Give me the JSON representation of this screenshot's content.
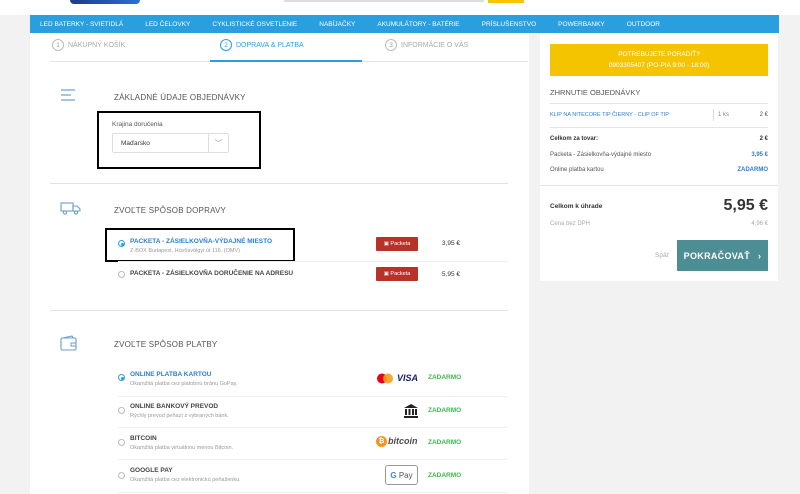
{
  "nav": [
    "LED BATERKY - SVIETIDLÁ",
    "LED ČELOVKY",
    "CYKLISTICKÉ OSVETLENIE",
    "NABÍJAČKY",
    "AKUMULÁTORY - BATÉRIE",
    "PRÍSLUŠENSTVO",
    "POWERBANKY",
    "OUTDOOR"
  ],
  "steps": [
    {
      "num": "1",
      "label": "NÁKUPNÝ KOŠÍK"
    },
    {
      "num": "2",
      "label": "DOPRAVA & PLATBA"
    },
    {
      "num": "3",
      "label": "INFORMÁCIE O VÁS"
    }
  ],
  "basic": {
    "title": "ZÁKLADNÉ ÚDAJE OBJEDNÁVKY",
    "country_label": "Krajina doručenia",
    "country_value": "Maďarsko",
    "chevron": "﹀"
  },
  "shipping": {
    "title": "ZVOĽTE SPÔSOB DOPRAVY",
    "badge": "Packeta",
    "options": [
      {
        "title": "PACKETA - ZÁSIELKOVŇA-VÝDAJNÉ MIESTO",
        "sub": "Z-BOX Budapest, Húvösvölgyi út 116. (OMV)",
        "price": "3,95 €",
        "selected": true
      },
      {
        "title": "PACKETA - ZÁSIELKOVŇA DORUČENIE NA ADRESU",
        "sub": "",
        "price": "5,95 €",
        "selected": false
      }
    ]
  },
  "payment": {
    "title": "ZVOĽTE SPÔSOB PLATBY",
    "free_label": "ZADARMO",
    "options": [
      {
        "title": "ONLINE PLATBA KARTOU",
        "sub": "Okamžitá platba cez platobnú bránu GoPay.",
        "logo": "visa-mastercard",
        "selected": true
      },
      {
        "title": "ONLINE BANKOVÝ PREVOD",
        "sub": "Rýchly prevod peňazí z vybraných bánk.",
        "logo": "bank-icon",
        "selected": false
      },
      {
        "title": "BITCOIN",
        "sub": "Okamžitá platba virtuálnou menou Bitcoin.",
        "logo": "bitcoin",
        "selected": false
      },
      {
        "title": "GOOGLE PAY",
        "sub": "Okamžitá platba cez elektronickú peňaženku.",
        "logo": "gpay",
        "selected": false
      }
    ],
    "visa_text": "VISA",
    "bitcoin_text": "bitcoin",
    "gpay_text": "Pay"
  },
  "summary": {
    "help_line1": "POTREBUJETE PORADIŤ?",
    "help_line2": "0903305407 (PO-PIA 9:00 - 18:00)",
    "title": "ZHRNUTIE OBJEDNÁVKY",
    "item_name": "KLIP NA NITECORE TIP ČIERNY - CLIP OF TIP",
    "item_qty": "1 ks",
    "item_price": "2 €",
    "goods_label": "Celkom za tovar:",
    "goods_value": "2 €",
    "ship_label": "Packeta - Zásielkovňa-výdajné miesto",
    "ship_value": "3,95 €",
    "pay_label": "Online platba kartou",
    "pay_value": "ZADARMO",
    "total_label": "Celkom k úhrade",
    "total_value": "5,95 €",
    "vat_label": "Cena bez DPH",
    "vat_value": "4,96 €",
    "back_label": "Späť",
    "continue_label": "POKRAČOVAŤ",
    "continue_arrow": "›"
  },
  "colors": {
    "accent": "#2a9fe0",
    "help": "#f5c400",
    "continue": "#4d8d94",
    "free": "#3cb94a",
    "packeta": "#b8322a"
  }
}
